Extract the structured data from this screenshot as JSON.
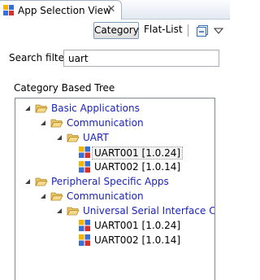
{
  "view": {
    "title": "App Selection View"
  },
  "toolbar": {
    "category_label": "Category",
    "flat_list_label": "Flat-List"
  },
  "filter": {
    "label": "Search filter",
    "value": "uart"
  },
  "tree": {
    "heading": "Category Based Tree",
    "nodes": [
      {
        "label": "Basic Applications",
        "type": "category",
        "expanded": true
      },
      {
        "label": "Communication",
        "type": "category",
        "expanded": true
      },
      {
        "label": "UART",
        "type": "category",
        "expanded": true
      },
      {
        "label": "UART001 [1.0.24]",
        "type": "app",
        "selected": true
      },
      {
        "label": "UART002 [1.0.14]",
        "type": "app"
      },
      {
        "label": "Peripheral Specific Apps",
        "type": "category",
        "expanded": true
      },
      {
        "label": "Communication",
        "type": "category",
        "expanded": true
      },
      {
        "label": "Universal Serial Interface Chann",
        "type": "category",
        "expanded": true
      },
      {
        "label": "UART001 [1.0.24]",
        "type": "app"
      },
      {
        "label": "UART002 [1.0.14]",
        "type": "app"
      }
    ]
  }
}
